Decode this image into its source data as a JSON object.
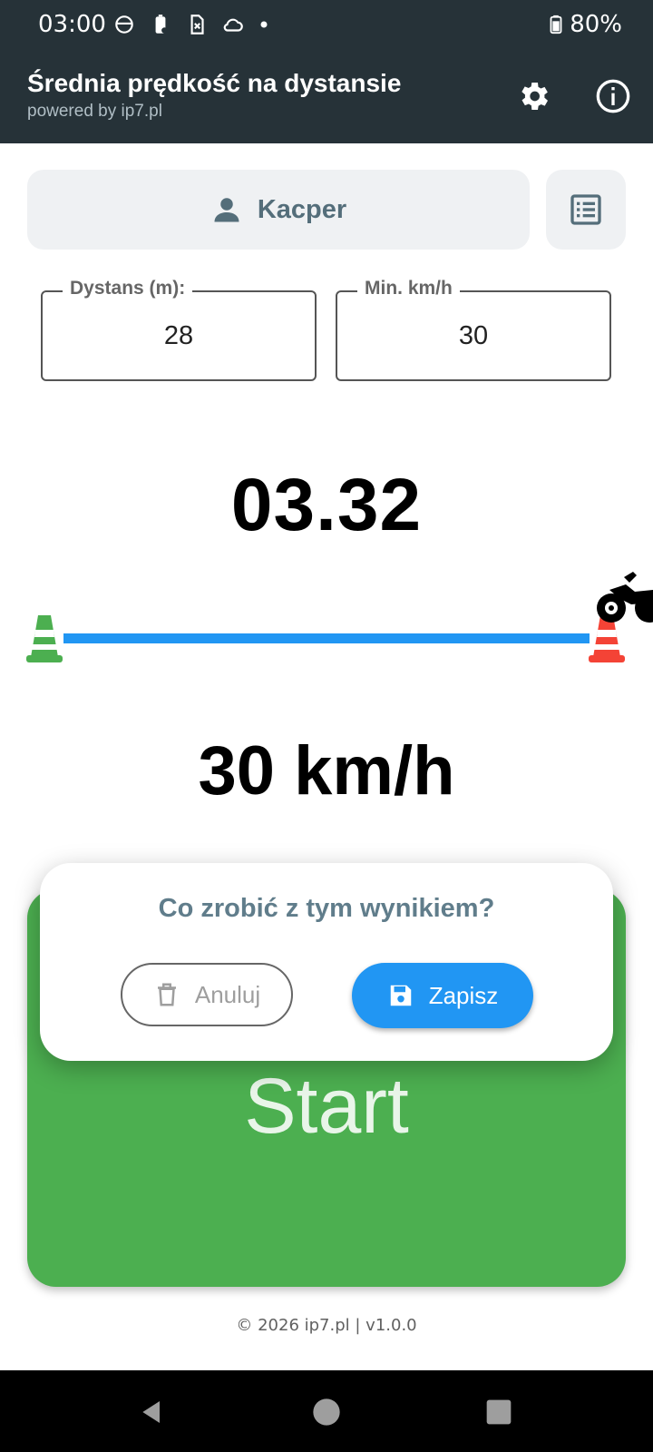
{
  "status_bar": {
    "time": "03:00",
    "battery": "80%",
    "icons": [
      "android-face-icon",
      "battery-alert-icon",
      "sim-off-icon",
      "cloud-icon",
      "dot-icon"
    ]
  },
  "app_bar": {
    "title": "Średnia prędkość na dystansie",
    "subtitle": "powered by ip7.pl",
    "actions": [
      "gear-icon",
      "info-icon"
    ]
  },
  "user": {
    "name": "Kacper"
  },
  "fields": {
    "distance": {
      "label": "Dystans (m):",
      "value": "28"
    },
    "min_speed": {
      "label": "Min. km/h",
      "value": "30"
    }
  },
  "timer": {
    "value": "03.32"
  },
  "track": {
    "progress": 1.0
  },
  "speed": {
    "value": "30 km/h"
  },
  "start_button": {
    "label": "Start"
  },
  "dialog": {
    "title": "Co zrobić z tym wynikiem?",
    "cancel_label": "Anuluj",
    "save_label": "Zapisz"
  },
  "footer": {
    "text": "© 2026 ip7.pl | v1.0.0"
  },
  "colors": {
    "app_bar": "#263238",
    "start": "#4caf50",
    "accent": "#2196f3",
    "cone_start": "#4caf50",
    "cone_finish": "#f44336"
  }
}
